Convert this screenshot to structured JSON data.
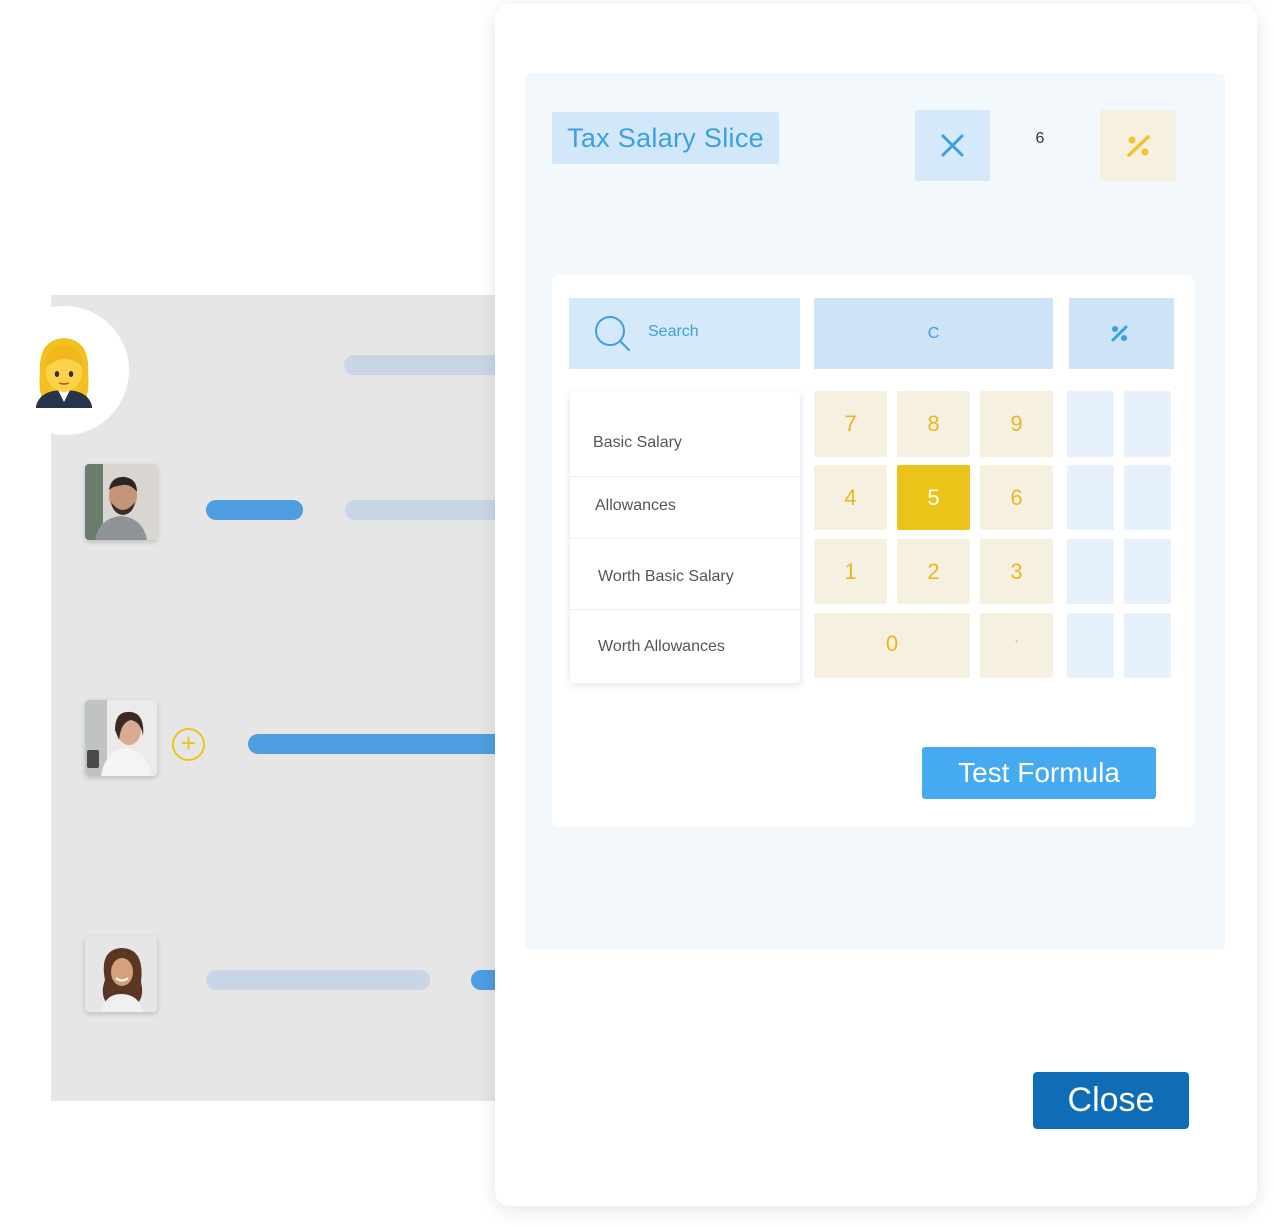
{
  "modal": {
    "title": "Tax Salary Slice",
    "count": "6",
    "search_label": "Search",
    "clear_label": "C",
    "variables": [
      "Basic Salary",
      "Allowances",
      "Worth Basic Salary",
      "Worth Allowances"
    ],
    "keypad": {
      "row1": [
        "7",
        "8",
        "9"
      ],
      "row2": [
        "4",
        "5",
        "6"
      ],
      "row3": [
        "1",
        "2",
        "3"
      ],
      "zero": "0",
      "dot": "."
    },
    "active_key": "5",
    "test_button": "Test Formula",
    "close_button": "Close"
  },
  "icons": {
    "user": "woman-emoji-icon",
    "close": "x-icon",
    "percent": "percent-icon",
    "search": "search-icon",
    "add": "plus-circle-icon"
  },
  "colors": {
    "accent_blue": "#3aa0e0",
    "accent_yellow": "#ecc319",
    "close_button": "#0f6db7",
    "test_button": "#45aaf0"
  }
}
